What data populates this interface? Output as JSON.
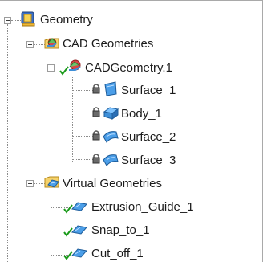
{
  "tree": {
    "root": {
      "label": "Geometry",
      "icon": "geometry-set-icon",
      "children": [
        {
          "label": "CAD Geometries",
          "icon": "cad-geometries-icon",
          "children": [
            {
              "label": "CADGeometry.1",
              "icon": "cad-geometry-icon",
              "status": "checked",
              "children": [
                {
                  "label": "Surface_1",
                  "icon": "surface-icon",
                  "lock": true
                },
                {
                  "label": "Body_1",
                  "icon": "body-icon",
                  "lock": true
                },
                {
                  "label": "Surface_2",
                  "icon": "surface-icon",
                  "lock": true
                },
                {
                  "label": "Surface_3",
                  "icon": "surface-icon",
                  "lock": true
                }
              ]
            }
          ]
        },
        {
          "label": "Virtual Geometries",
          "icon": "virtual-geometries-icon",
          "children": [
            {
              "label": "Extrusion_Guide_1",
              "icon": "virtual-geometry-icon",
              "status": "checked"
            },
            {
              "label": "Snap_to_1",
              "icon": "virtual-geometry-icon",
              "status": "checked"
            },
            {
              "label": "Cut_off_1",
              "icon": "virtual-geometry-icon",
              "status": "checked"
            }
          ]
        }
      ]
    }
  },
  "colors": {
    "tree_line": "#8c8c8c",
    "check": "#1a9a1a",
    "surface_blue": "#3d8fd8",
    "folder_yellow": "#f3c94a"
  }
}
